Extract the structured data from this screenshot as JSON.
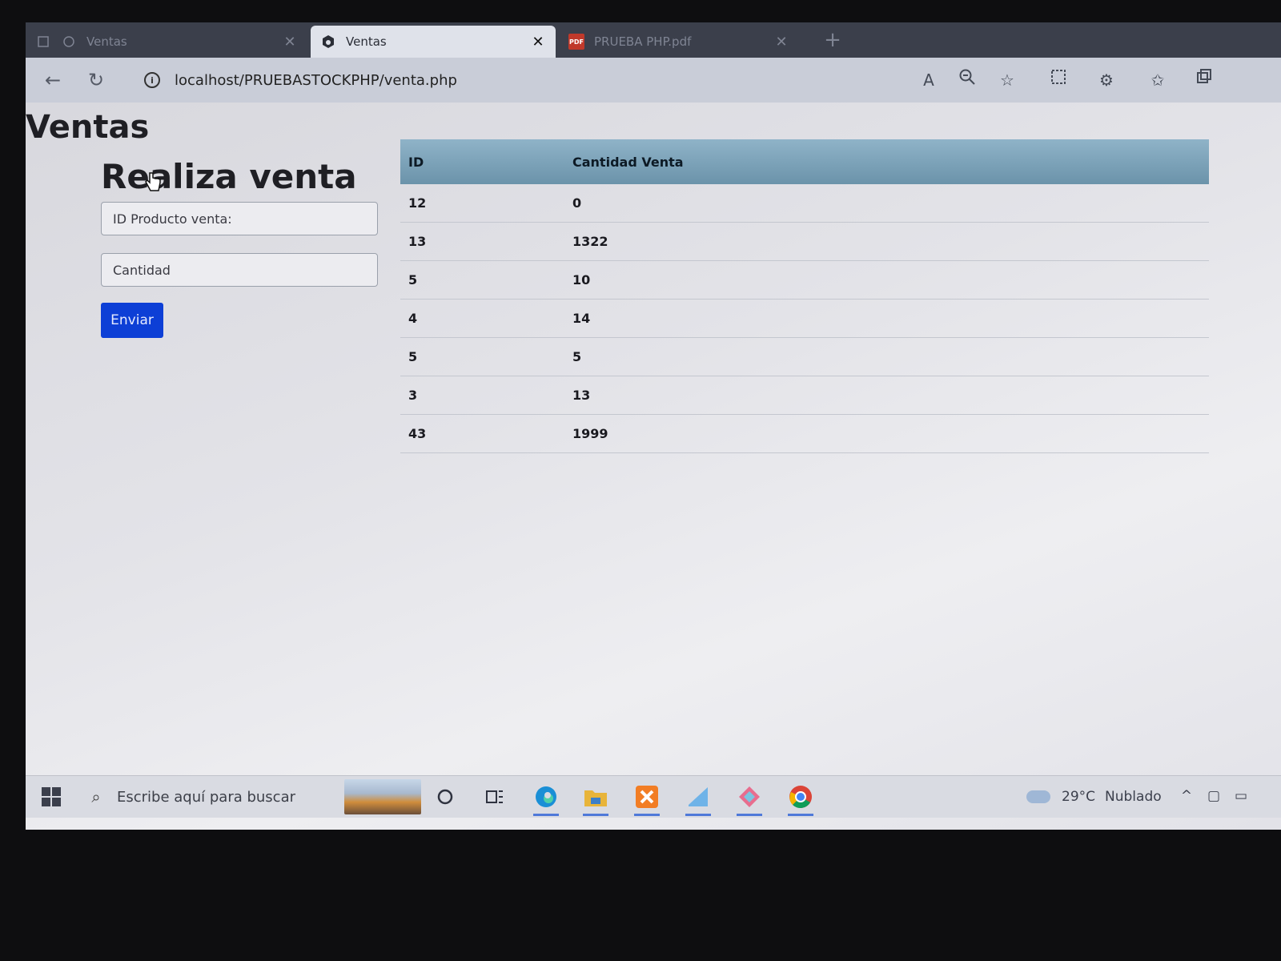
{
  "browser": {
    "tabs": [
      {
        "label": "Ventas",
        "active": false
      },
      {
        "label": "Ventas",
        "active": true
      },
      {
        "label": "PRUEBA PHP.pdf",
        "active": false
      }
    ],
    "url": "localhost/PRUEBASTOCKPHP/venta.php"
  },
  "page": {
    "title": "Ventas",
    "form": {
      "title": "Realiza venta",
      "id_placeholder": "ID Producto venta:",
      "quantity_placeholder": "Cantidad",
      "submit_label": "Enviar"
    },
    "table": {
      "headers": [
        "ID",
        "Cantidad Venta"
      ],
      "rows": [
        [
          "12",
          "0"
        ],
        [
          "13",
          "1322"
        ],
        [
          "5",
          "10"
        ],
        [
          "4",
          "14"
        ],
        [
          "5",
          "5"
        ],
        [
          "3",
          "13"
        ],
        [
          "43",
          "1999"
        ]
      ]
    }
  },
  "taskbar": {
    "search_placeholder": "Escribe aquí para buscar",
    "weather_temp": "29°C",
    "weather_desc": "Nublado"
  },
  "colors": {
    "button": "#0d3fd6",
    "table_header": "#7ea3b9"
  }
}
